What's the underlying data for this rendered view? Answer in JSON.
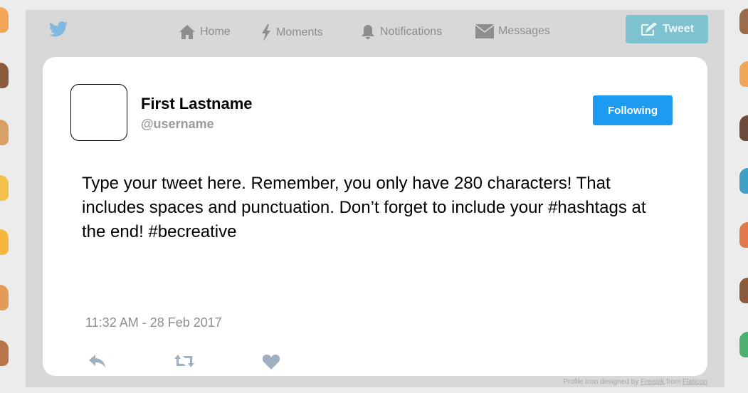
{
  "nav": {
    "items": [
      {
        "label": "Home",
        "icon": "home-icon"
      },
      {
        "label": "Moments",
        "icon": "lightning-icon"
      },
      {
        "label": "Notifications",
        "icon": "bell-icon"
      },
      {
        "label": "Messages",
        "icon": "envelope-icon"
      }
    ],
    "tweet_label": "Tweet"
  },
  "profile": {
    "name": "First Lastname",
    "handle": "@username",
    "follow_label": "Following"
  },
  "tweet": {
    "text": "Type your tweet here.  Remember, you only have 280 characters! That includes spaces and punctuation. Don’t forget to include your #hashtags at the end! #becreative",
    "timestamp": "11:32 AM - 28 Feb 2017"
  },
  "credit": {
    "prefix": "Profile icon designed by ",
    "author": "Freepik",
    "middle": " from ",
    "site": "Flaticon"
  },
  "colors": {
    "accent": "#1d9bf0",
    "tweet_button": "#7fc2cf",
    "nav_text": "#8e8e8e",
    "frame": "#d8d8d8"
  }
}
